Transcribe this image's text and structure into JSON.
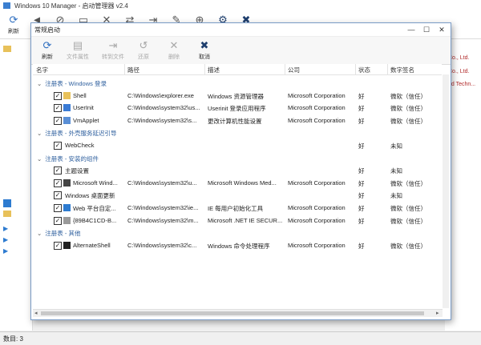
{
  "app": {
    "title": "Windows 10 Manager - 启动管理器 v2.4",
    "toolbar": [
      {
        "label": "刷新",
        "icon": "refresh-icon"
      },
      {
        "label": "",
        "icon": "back-icon"
      },
      {
        "label": "",
        "icon": "forbid-icon"
      },
      {
        "label": "",
        "icon": "new-icon"
      },
      {
        "label": "",
        "icon": "delete-icon"
      },
      {
        "label": "",
        "icon": "swap-icon"
      },
      {
        "label": "",
        "icon": "arrow-right-icon"
      },
      {
        "label": "",
        "icon": "edit-icon"
      },
      {
        "label": "",
        "icon": "globe-icon"
      },
      {
        "label": "",
        "icon": "gear-icon"
      },
      {
        "label": "",
        "icon": "close-circle-icon"
      }
    ],
    "right_strip": [
      "Co., Ltd.",
      "Co., Ltd.",
      "nd Techn..."
    ],
    "status": "数目: 3"
  },
  "dialog": {
    "title": "常规启动",
    "window_controls": {
      "minimize": "—",
      "maximize": "☐",
      "close": "✕"
    },
    "toolbar": [
      {
        "label": "刷新",
        "icon": "refresh-icon",
        "enabled": true
      },
      {
        "label": "文件属性",
        "icon": "comment-icon",
        "enabled": false
      },
      {
        "label": "转到文件",
        "icon": "goto-icon",
        "enabled": false
      },
      {
        "label": "还原",
        "icon": "restore-icon",
        "enabled": false
      },
      {
        "label": "删除",
        "icon": "delete-icon",
        "enabled": false
      },
      {
        "label": "取消",
        "icon": "cancel-icon",
        "enabled": true
      }
    ],
    "columns": [
      "名字",
      "路径",
      "描述",
      "公司",
      "状态",
      "数字签名"
    ],
    "rows": [
      {
        "type": "group",
        "label": "注册表 - Windows 登录"
      },
      {
        "type": "item",
        "checked": true,
        "icon": "folder-icon",
        "name": "Shell",
        "path": "C:\\Windows\\explorer.exe",
        "desc": "Windows 资源管理器",
        "company": "Microsoft Corporation",
        "state": "好",
        "sig": "微软（信任）"
      },
      {
        "type": "item",
        "checked": true,
        "icon": "window-icon",
        "name": "UserInit",
        "path": "C:\\Windows\\system32\\us...",
        "desc": "Userinit 登录应用程序",
        "company": "Microsoft Corporation",
        "state": "好",
        "sig": "微软（信任）"
      },
      {
        "type": "item",
        "checked": true,
        "icon": "applet-icon",
        "name": "VmApplet",
        "path": "C:\\Windows\\system32\\s...",
        "desc": "更改计算机性能设置",
        "company": "Microsoft Corporation",
        "state": "好",
        "sig": "微软（信任）"
      },
      {
        "type": "group",
        "label": "注册表 - 外壳服务延迟引导"
      },
      {
        "type": "item",
        "checked": true,
        "icon": "",
        "name": "WebCheck",
        "path": "",
        "desc": "",
        "company": "",
        "state": "好",
        "sig": "未知"
      },
      {
        "type": "group",
        "label": "注册表 - 安装的组件"
      },
      {
        "type": "item",
        "checked": true,
        "icon": "",
        "name": "主题设置",
        "path": "",
        "desc": "",
        "company": "",
        "state": "好",
        "sig": "未知"
      },
      {
        "type": "item",
        "checked": true,
        "icon": "media-icon",
        "name": "Microsoft Wind...",
        "path": "C:\\Windows\\system32\\u...",
        "desc": "Microsoft Windows Med...",
        "company": "Microsoft Corporation",
        "state": "好",
        "sig": "微软（信任）"
      },
      {
        "type": "item",
        "checked": true,
        "icon": "",
        "name": "Windows 桌面更新",
        "path": "",
        "desc": "",
        "company": "",
        "state": "好",
        "sig": "未知"
      },
      {
        "type": "item",
        "checked": true,
        "icon": "ie-icon",
        "name": "Web 平台自定...",
        "path": "C:\\Windows\\system32\\ie...",
        "desc": "IE 每用户初始化工具",
        "company": "Microsoft Corporation",
        "state": "好",
        "sig": "微软（信任）"
      },
      {
        "type": "item",
        "checked": true,
        "icon": "file-icon",
        "name": "{89B4C1CD-B...",
        "path": "C:\\Windows\\system32\\m...",
        "desc": "Microsoft .NET IE SECUR...",
        "company": "Microsoft Corporation",
        "state": "好",
        "sig": "微软（信任）"
      },
      {
        "type": "group",
        "label": "注册表 - 其他"
      },
      {
        "type": "item",
        "checked": true,
        "icon": "cmd-icon",
        "name": "AlternateShell",
        "path": "C:\\Windows\\system32\\c...",
        "desc": "Windows 命令处理程序",
        "company": "Microsoft Corporation",
        "state": "好",
        "sig": "微软（信任）"
      }
    ]
  }
}
